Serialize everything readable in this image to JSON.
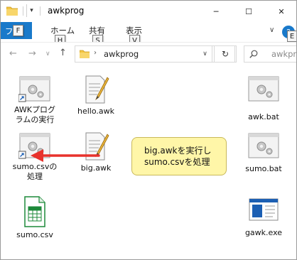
{
  "window": {
    "title": "awkprog",
    "minimize_glyph": "─",
    "maximize_glyph": "☐",
    "close_glyph": "✕"
  },
  "ribbon": {
    "tabs": [
      {
        "label": "ファ",
        "keytip": "F"
      },
      {
        "label": "ホーム",
        "keytip": "H"
      },
      {
        "label": "共有",
        "keytip": "S"
      },
      {
        "label": "表示",
        "keytip": "V"
      }
    ],
    "expand_glyph": "∨",
    "help_keytip": "E"
  },
  "nav": {
    "back_glyph": "←",
    "forward_glyph": "→",
    "recent_glyph": "∨",
    "up_glyph": "↑",
    "address_chevron": "›",
    "address_text": "awkprog",
    "dropdown_glyph": "∨",
    "refresh_glyph": "↻",
    "search_placeholder": "awkprog"
  },
  "files": [
    {
      "name": "AWKプログラムの実行",
      "line1": "AWKプログ",
      "line2": "ラムの実行",
      "icon": "shortcut-gear-icon"
    },
    {
      "name": "hello.awk",
      "line1": "hello.awk",
      "line2": "",
      "icon": "awk-script-icon"
    },
    {
      "name": "awk.bat",
      "line1": "awk.bat",
      "line2": "",
      "icon": "batch-gear-icon"
    },
    {
      "name": "sumo.csvの処理",
      "line1": "sumo.csvの",
      "line2": "処理",
      "icon": "shortcut-gear-icon"
    },
    {
      "name": "big.awk",
      "line1": "big.awk",
      "line2": "",
      "icon": "awk-script-icon"
    },
    {
      "name": "sumo.bat",
      "line1": "sumo.bat",
      "line2": "",
      "icon": "batch-gear-icon"
    },
    {
      "name": "sumo.csv",
      "line1": "sumo.csv",
      "line2": "",
      "icon": "spreadsheet-csv-icon"
    },
    {
      "name": "gawk.exe",
      "line1": "gawk.exe",
      "line2": "",
      "icon": "exe-app-icon"
    }
  ],
  "callout": {
    "line1": "big.awkを実行し",
    "line2": "sumo.csvを処理"
  },
  "colors": {
    "ribbon_file_tab": "#1979ca",
    "folder_yellow": "#f4c542",
    "callout_bg": "#fff6a8",
    "arrow_red": "#e8322c",
    "csv_green": "#1d8a3a"
  }
}
